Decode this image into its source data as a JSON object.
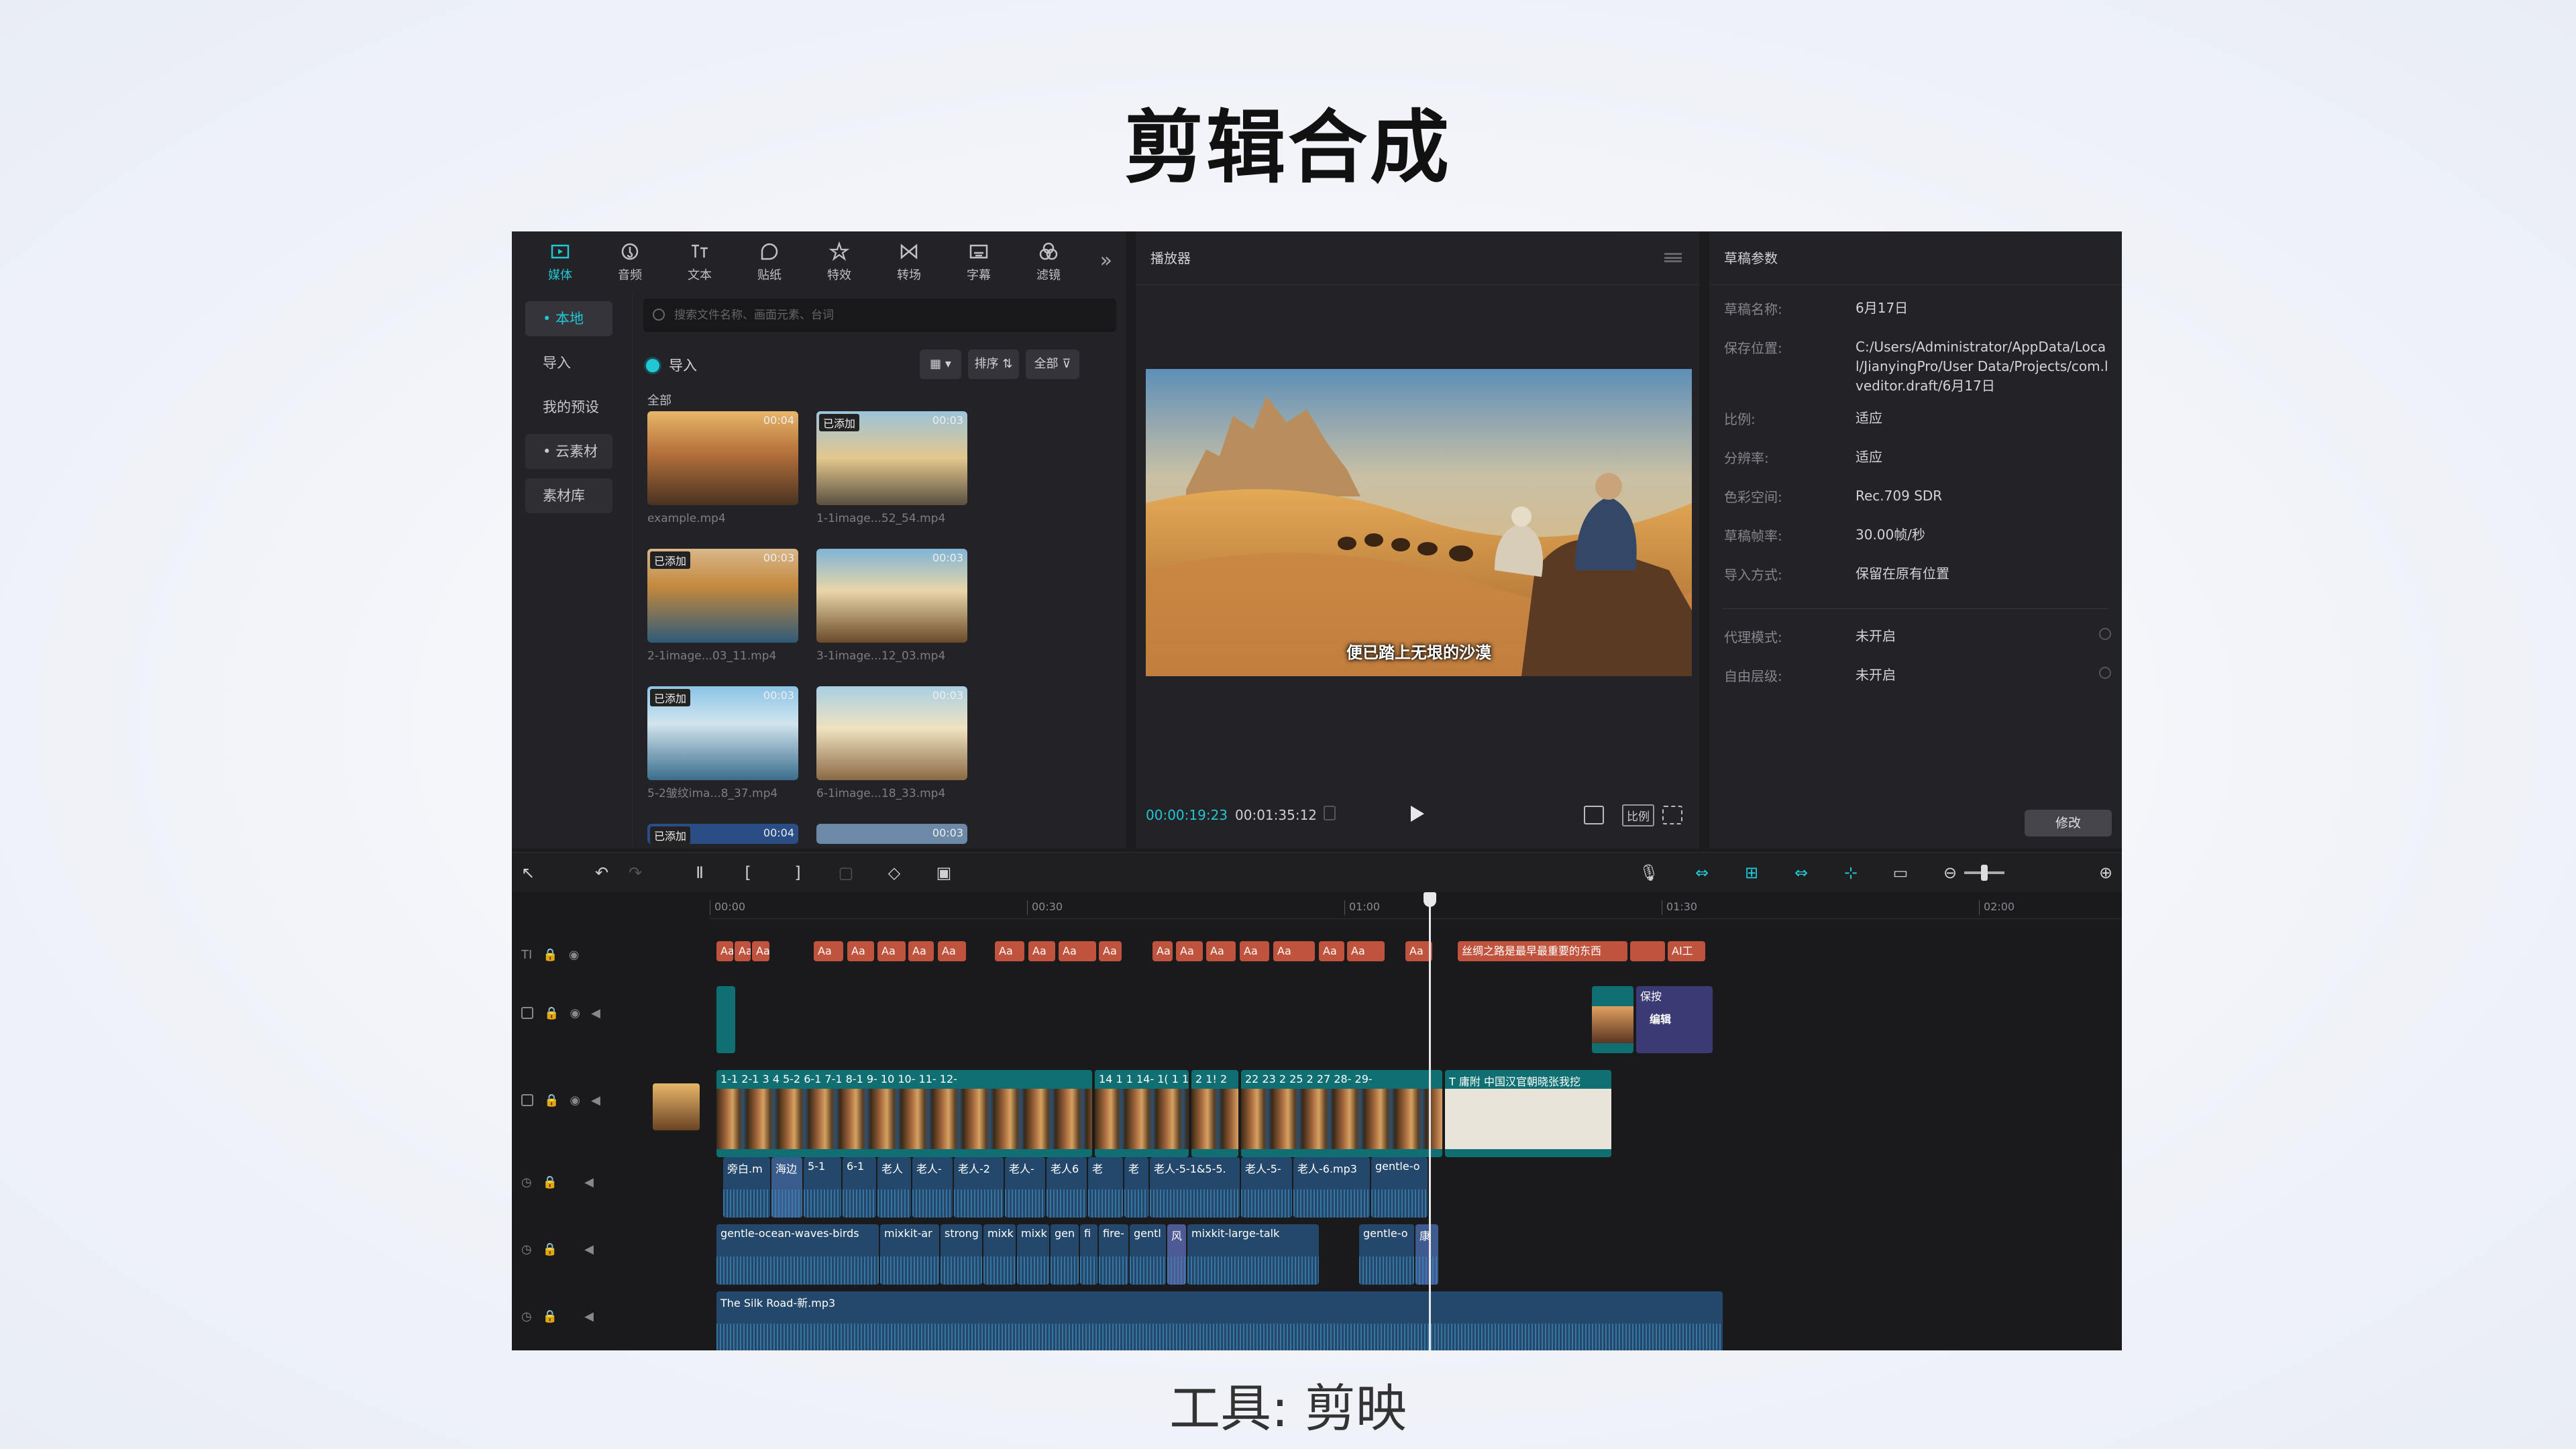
{
  "slide": {
    "title": "剪辑合成",
    "caption": "工具: 剪映"
  },
  "top_tabs": [
    {
      "label": "媒体",
      "icon": "media-icon",
      "active": true
    },
    {
      "label": "音频",
      "icon": "audio-icon"
    },
    {
      "label": "文本",
      "icon": "text-icon"
    },
    {
      "label": "贴纸",
      "icon": "sticker-icon"
    },
    {
      "label": "特效",
      "icon": "effects-icon"
    },
    {
      "label": "转场",
      "icon": "transition-icon"
    },
    {
      "label": "字幕",
      "icon": "subtitle-icon"
    },
    {
      "label": "滤镜",
      "icon": "filter-icon"
    }
  ],
  "side_nav": [
    "• 本地",
    "导入",
    "我的预设",
    "• 云素材",
    "素材库"
  ],
  "media": {
    "search_placeholder": "搜索文件名称、画面元素、台词",
    "import_label": "导入",
    "sort_label": "排序",
    "filter_label": "全部",
    "all_label": "全部",
    "items": [
      {
        "name": "example.mp4",
        "duration": "00:04",
        "added": ""
      },
      {
        "name": "1-1image...52_54.mp4",
        "duration": "00:03",
        "added": "已添加"
      },
      {
        "name": "2-1image...03_11.mp4",
        "duration": "00:03",
        "added": "已添加"
      },
      {
        "name": "3-1image...12_03.mp4",
        "duration": "00:03",
        "added": ""
      },
      {
        "name": "5-2皱纹ima...8_37.mp4",
        "duration": "00:03",
        "added": "已添加"
      },
      {
        "name": "6-1image...18_33.mp4",
        "duration": "00:03",
        "added": ""
      },
      {
        "name": "",
        "duration": "00:04",
        "added": "已添加"
      },
      {
        "name": "",
        "duration": "00:03",
        "added": ""
      }
    ]
  },
  "player": {
    "title": "播放器",
    "subtitle": "便已踏上无垠的沙漠",
    "current_time": "00:00:19:23",
    "total_time": "00:01:35:12",
    "ratio_label": "比例"
  },
  "params": {
    "title": "草稿参数",
    "rows": [
      {
        "key": "草稿名称:",
        "value": "6月17日"
      },
      {
        "key": "保存位置:",
        "value": "C:/Users/Administrator/AppData/Local/JianyingPro/User Data/Projects/com.lveditor.draft/6月17日"
      },
      {
        "key": "比例:",
        "value": "适应"
      },
      {
        "key": "分辨率:",
        "value": "适应"
      },
      {
        "key": "色彩空间:",
        "value": "Rec.709 SDR"
      },
      {
        "key": "草稿帧率:",
        "value": "30.00帧/秒"
      },
      {
        "key": "导入方式:",
        "value": "保留在原有位置"
      }
    ],
    "rows2": [
      {
        "key": "代理模式:",
        "value": "未开启"
      },
      {
        "key": "自由层级:",
        "value": "未开启"
      }
    ],
    "modify_label": "修改"
  },
  "timeline": {
    "ticks": [
      "00:00",
      "00:30",
      "01:00",
      "01:30",
      "02:00"
    ],
    "text_track_long": "丝绸之路是最早最重要的东西",
    "text_track_end": "AI工",
    "overlay_clip": "编辑",
    "overlay_clip2": "保按",
    "video_last_label": "T 庸附 中国汉官朝晓张我挖",
    "audio1": [
      "旁白.m",
      "海边",
      "5-1",
      "6-1",
      "老人",
      "老人-",
      "老人-2",
      "老人-",
      "老人6",
      "老",
      "老人-5-1&5-5.",
      "老人-5-",
      "老人-6.mp3",
      "gentle-o"
    ],
    "audio2": [
      "gentle-ocean-waves-birds",
      "mixkit-ar",
      "strong",
      "mixk",
      "mixk",
      "gen",
      "fi",
      "fire-",
      "gentl",
      "风",
      "mixkit-large-talk",
      "gentle-o",
      "康"
    ],
    "music": "The Silk Road-新.mp3"
  },
  "colors": {
    "accent": "#21c8d4",
    "text_clip": "#c0533d",
    "video_clip": "#0f6f72",
    "audio_clip": "#24486b"
  }
}
